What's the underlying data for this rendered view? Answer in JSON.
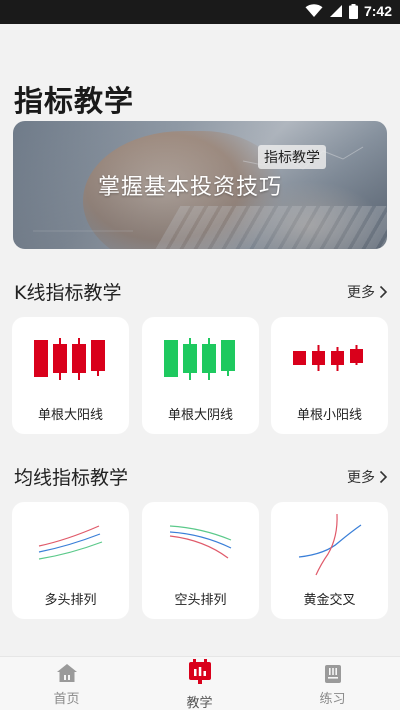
{
  "status": {
    "time": "7:42"
  },
  "page_title": "指标教学",
  "banner": {
    "tag": "指标教学",
    "headline": "掌握基本投资技巧"
  },
  "sections": [
    {
      "title": "K线指标教学",
      "more": "更多",
      "cards": [
        {
          "label": "单根大阳线",
          "color": "#d9001b"
        },
        {
          "label": "单根大阴线",
          "color": "#1ec95f"
        },
        {
          "label": "单根小阳线",
          "color": "#d9001b"
        }
      ]
    },
    {
      "title": "均线指标教学",
      "more": "更多",
      "cards": [
        {
          "label": "多头排列"
        },
        {
          "label": "空头排列"
        },
        {
          "label": "黄金交叉"
        }
      ]
    }
  ],
  "tabs": [
    {
      "label": "首页",
      "icon": "home-icon",
      "active": false
    },
    {
      "label": "教学",
      "icon": "chart-board-icon",
      "active": true
    },
    {
      "label": "练习",
      "icon": "notebook-icon",
      "active": false
    }
  ],
  "colors": {
    "accent": "#d9001b",
    "inactive": "#8a8a8a"
  }
}
